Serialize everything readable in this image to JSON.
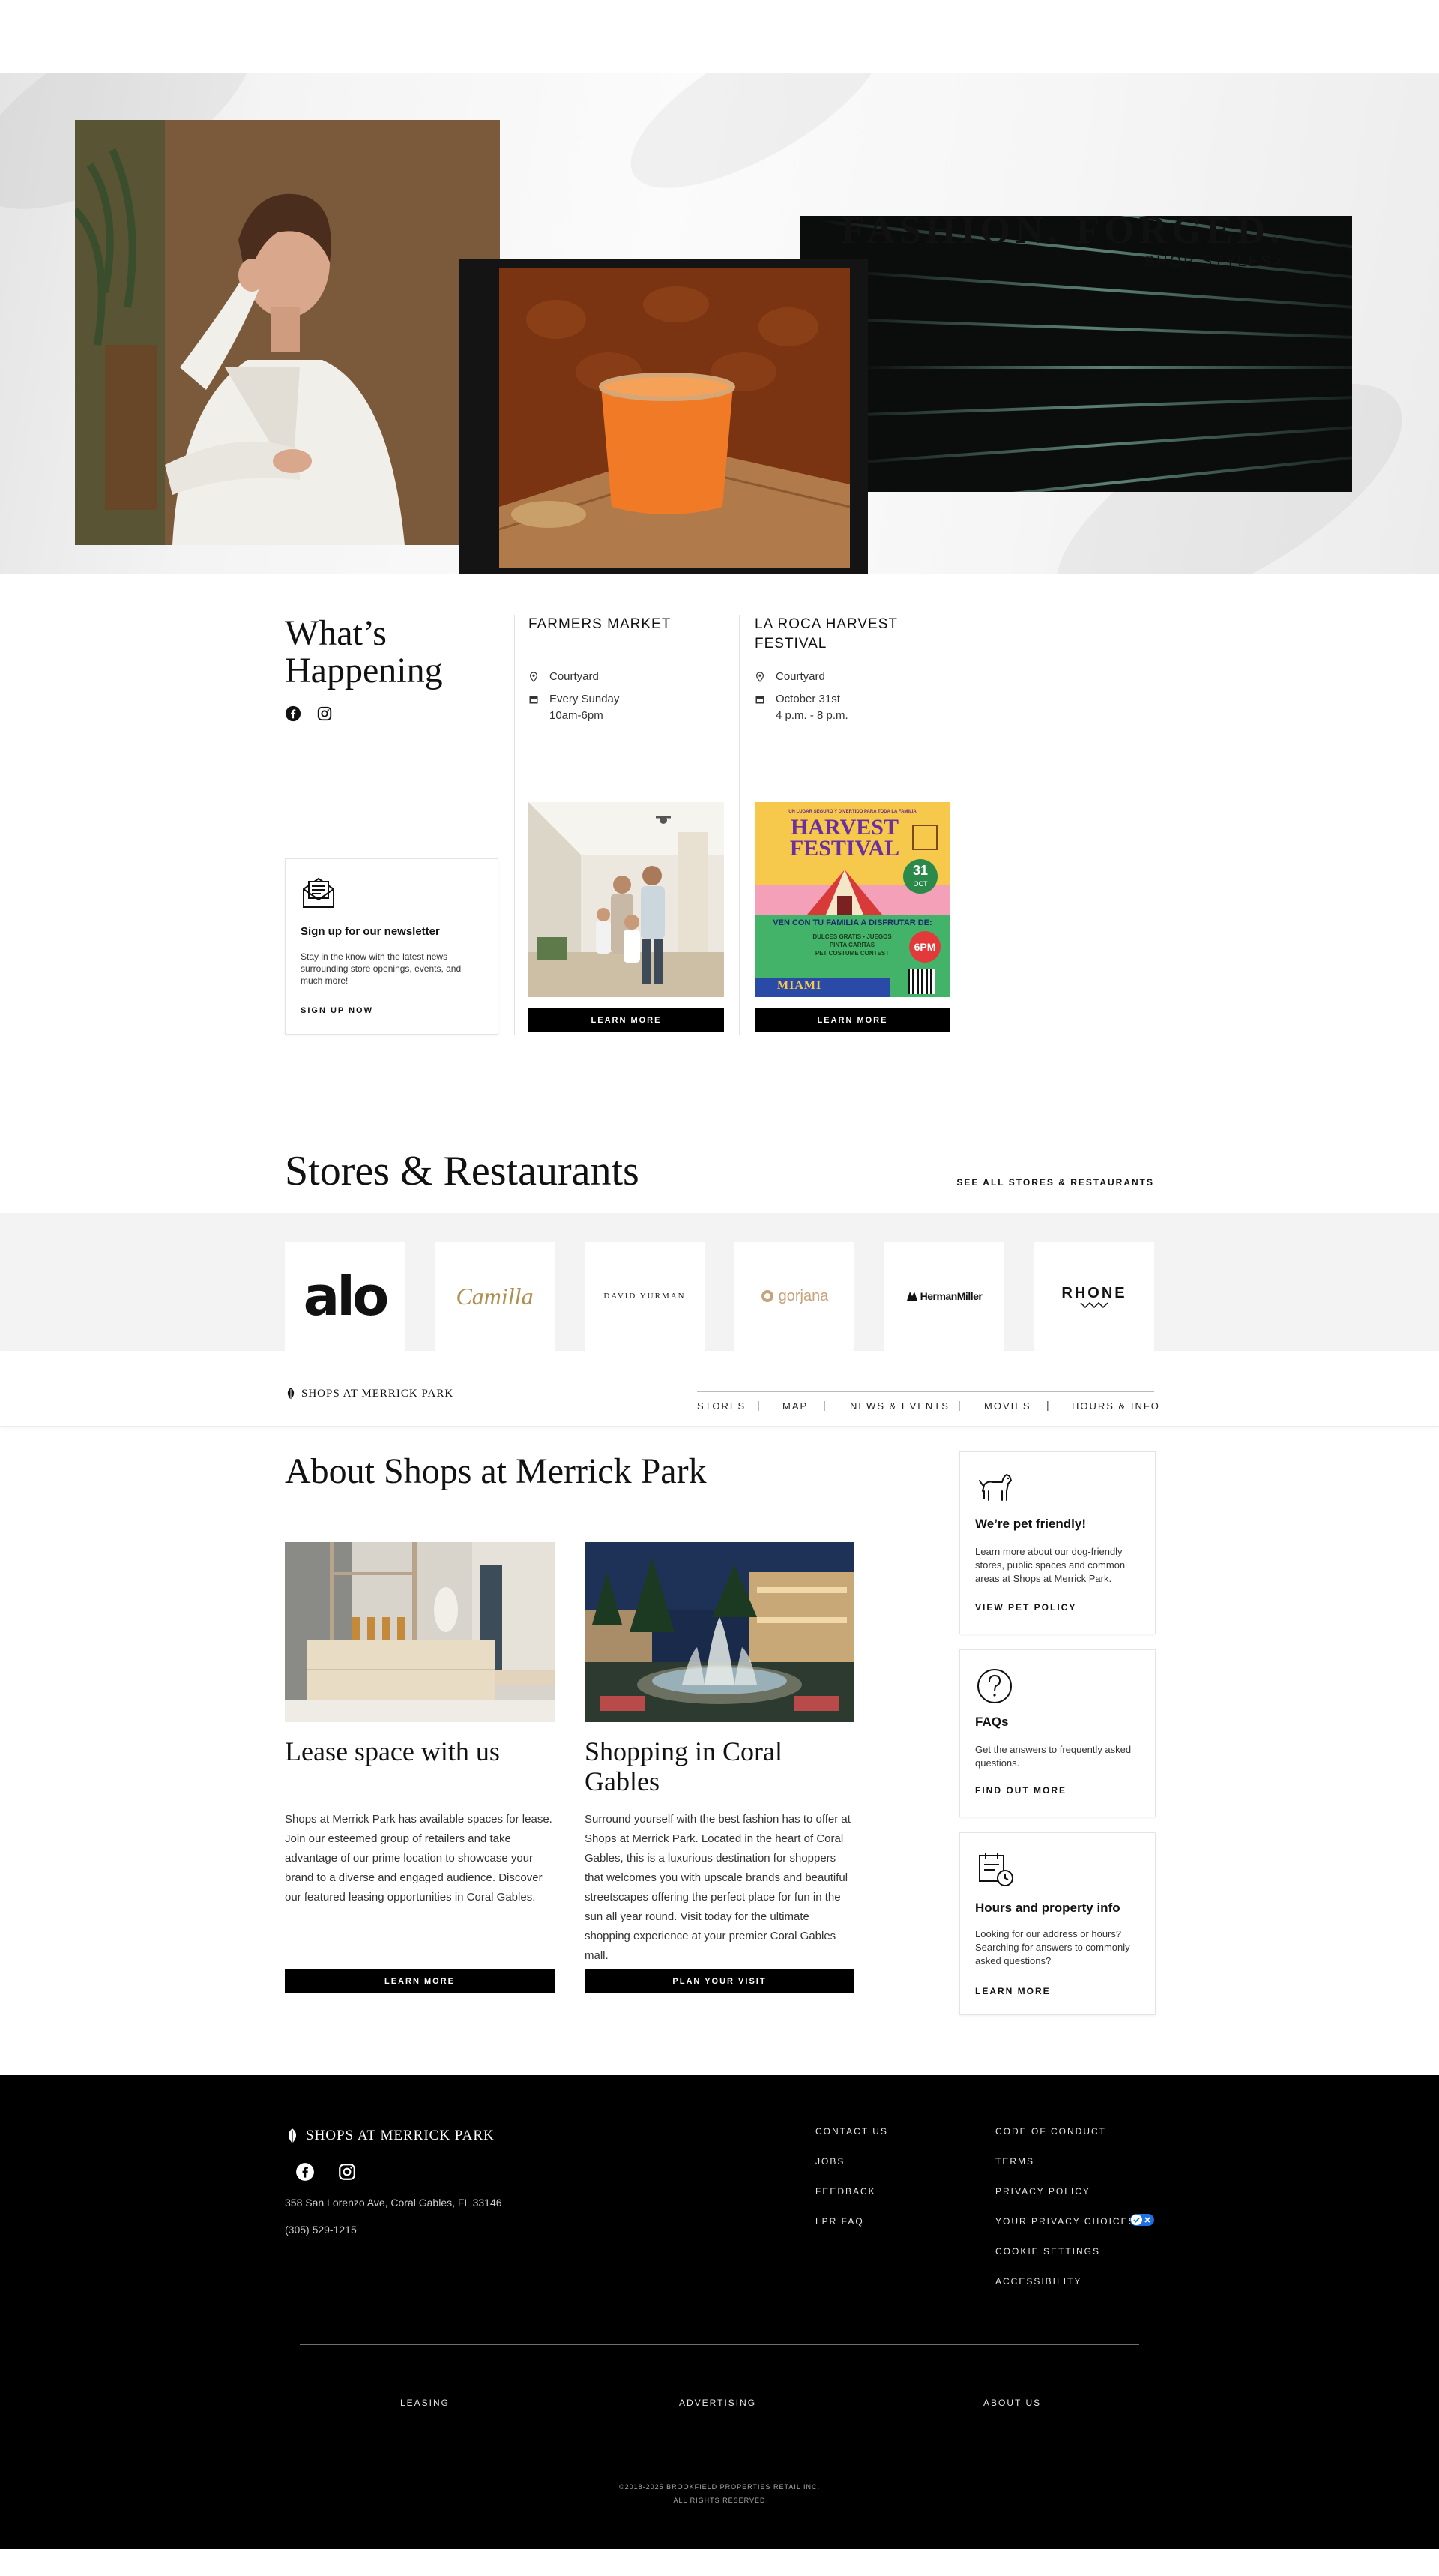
{
  "hero": {
    "title": "FASHION. FORGED.",
    "cta": "SHOP STYLES>"
  },
  "happening": {
    "title_line1": "What’s",
    "title_line2": "Happening",
    "social": [
      "facebook-icon",
      "instagram-icon"
    ],
    "newsletter": {
      "title": "Sign up for our newsletter",
      "body": "Stay in the know with the latest news surrounding store openings, events, and much more!",
      "link": "SIGN UP NOW"
    },
    "events": [
      {
        "title": "FARMERS MARKET",
        "location": "Courtyard",
        "when": "Every Sunday\n10am-6pm",
        "button": "LEARN MORE"
      },
      {
        "title": "LA ROCA HARVEST\nFESTIVAL",
        "location": "Courtyard",
        "when": "October 31st\n4 p.m. - 8 p.m.",
        "button": "LEARN MORE",
        "poster": {
          "top_text": "UN LUGAR SEGURO Y DIVERTIDO PARA TODA LA FAMILIA",
          "headline": "HARVEST FESTIVAL",
          "date_day": "31",
          "date_month": "OCT",
          "time": "6PM",
          "banner": "VEN CON TU FAMILIA A DISFRUTAR DE:",
          "items": "DULCES GRATIS • JUEGOS\nPINTA CARITAS\nPET COSTUME CONTEST",
          "footer": "MIAMI"
        }
      }
    ]
  },
  "stores": {
    "title": "Stores & Restaurants",
    "link": "SEE ALL STORES & RESTAURANTS",
    "brands": [
      "alo",
      "Camilla",
      "DAVID YURMAN",
      "gorjana",
      "HermanMiller",
      "RHONE"
    ]
  },
  "nav": {
    "logo": "SHOPS AT MERRICK PARK",
    "items": [
      "STORES",
      "MAP",
      "NEWS & EVENTS",
      "MOVIES",
      "HOURS & INFO"
    ],
    "separator": "|"
  },
  "about": {
    "title": "About Shops at Merrick Park",
    "cards": [
      {
        "title": "Lease space with us",
        "body": "Shops at Merrick Park has available spaces for lease. Join our esteemed group of retailers and take advantage of our prime location to showcase your brand to a diverse and engaged audience. Discover our featured leasing opportunities in Coral Gables.",
        "button": "LEARN MORE"
      },
      {
        "title": "Shopping in Coral Gables",
        "body": "Surround yourself with the best fashion has to offer at Shops at Merrick Park. Located in the heart of Coral Gables, this is a luxurious destination for shoppers that welcomes you with upscale brands and beautiful streetscapes offering the perfect place for fun in the sun all year round. Visit today for the ultimate shopping experience at your premier Coral Gables mall.",
        "button": "PLAN YOUR VISIT"
      }
    ],
    "side": [
      {
        "title": "We’re pet friendly!",
        "body": "Learn more about our dog-friendly stores, public spaces and common areas at Shops at Merrick Park.",
        "link": "VIEW PET POLICY"
      },
      {
        "title": "FAQs",
        "body": "Get the answers to frequently asked questions.",
        "link": "FIND OUT MORE"
      },
      {
        "title": "Hours and property info",
        "body": "Looking for our address or hours? Searching for answers to commonly asked questions?",
        "link": "LEARN MORE"
      }
    ]
  },
  "footer": {
    "logo": "SHOPS AT MERRICK PARK",
    "address": "358 San Lorenzo Ave, Coral Gables, FL 33146",
    "phone": "(305) 529-1215",
    "col1": [
      "CONTACT US",
      "JOBS",
      "FEEDBACK",
      "LPR FAQ"
    ],
    "col2": [
      "CODE OF CONDUCT",
      "TERMS",
      "PRIVACY POLICY",
      "YOUR PRIVACY CHOICES",
      "COOKIE SETTINGS",
      "ACCESSIBILITY"
    ],
    "bottom_links": [
      "LEASING",
      "ADVERTISING",
      "ABOUT US"
    ],
    "copyright_1": "©2018-2025 BROOKFIELD PROPERTIES RETAIL INC.",
    "copyright_2": "ALL RIGHTS RESERVED"
  },
  "colors": {
    "black": "#000000",
    "privacy_toggle_blue": "#1f6fe5",
    "gorjana_gold": "#c8a27a",
    "camilla_gold": "#b09050"
  }
}
